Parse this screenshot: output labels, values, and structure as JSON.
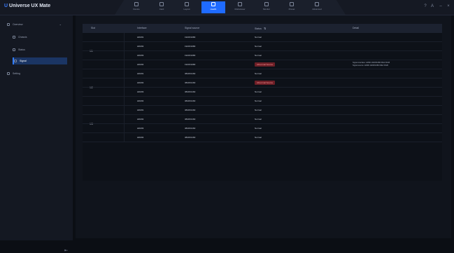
{
  "app": {
    "brand_prefix": "U",
    "brand_name": "Universe UX Mate"
  },
  "nav": {
    "tabs": [
      {
        "label": "Device",
        "active": false
      },
      {
        "label": "Card",
        "active": false
      },
      {
        "label": "Layout",
        "active": false
      },
      {
        "label": "Health",
        "active": true
      },
      {
        "label": "Multiviewer",
        "active": false
      },
      {
        "label": "Monitor",
        "active": false
      },
      {
        "label": "Preset",
        "active": false
      },
      {
        "label": "Advanced",
        "active": false
      }
    ]
  },
  "window_controls": {
    "help": "?",
    "user": "A",
    "min": "–",
    "close": "×"
  },
  "sidebar": {
    "group_label": "Overview",
    "items": [
      {
        "label": "Chassis",
        "active": false
      },
      {
        "label": "Status",
        "active": false
      },
      {
        "label": "Signal",
        "active": true
      }
    ],
    "bottom_item": "Setting"
  },
  "table": {
    "headers": {
      "slot": "Slot",
      "interface": "Interface",
      "signal": "Signal source",
      "status": "Status",
      "detail": "Detail"
    },
    "groups": [
      {
        "slot": "1/1",
        "rows": [
          {
            "interface": "HDMI1",
            "signal": "1920X1080",
            "status": "Normal",
            "err": false
          },
          {
            "interface": "HDMI2",
            "signal": "1920X1080",
            "status": "Normal",
            "err": false
          },
          {
            "interface": "HDMI3",
            "signal": "1920X1080",
            "status": "Normal",
            "err": false
          },
          {
            "interface": "HDMI4",
            "signal": "1920X1080",
            "status": "Abnormal Source",
            "err": true
          }
        ]
      },
      {
        "slot": "1/2",
        "rows": [
          {
            "interface": "HDMI1",
            "signal": "3840X2160",
            "status": "Normal",
            "err": false
          },
          {
            "interface": "HDMI2",
            "signal": "3840X2160",
            "status": "Abnormal Source",
            "err": true
          },
          {
            "interface": "HDMI3",
            "signal": "3840X2160",
            "status": "Normal",
            "err": false
          },
          {
            "interface": "HDMI4",
            "signal": "3840X2160",
            "status": "Normal",
            "err": false
          }
        ]
      },
      {
        "slot": "1/3",
        "rows": [
          {
            "interface": "HDMI1",
            "signal": "3840X2160",
            "status": "Normal",
            "err": false
          },
          {
            "interface": "HDMI2",
            "signal": "3840X2160",
            "status": "Normal",
            "err": false
          },
          {
            "interface": "HDMI3",
            "signal": "3840X2160",
            "status": "Normal",
            "err": false
          },
          {
            "interface": "HDMI4",
            "signal": "3840X2160",
            "status": "Normal",
            "err": false
          }
        ]
      }
    ],
    "detail_lines": [
      "Signal interface: HDMI 1920X1080 60Hz RGB",
      "Signal source: HDMI 1920X1080 60Hz RGB"
    ]
  }
}
